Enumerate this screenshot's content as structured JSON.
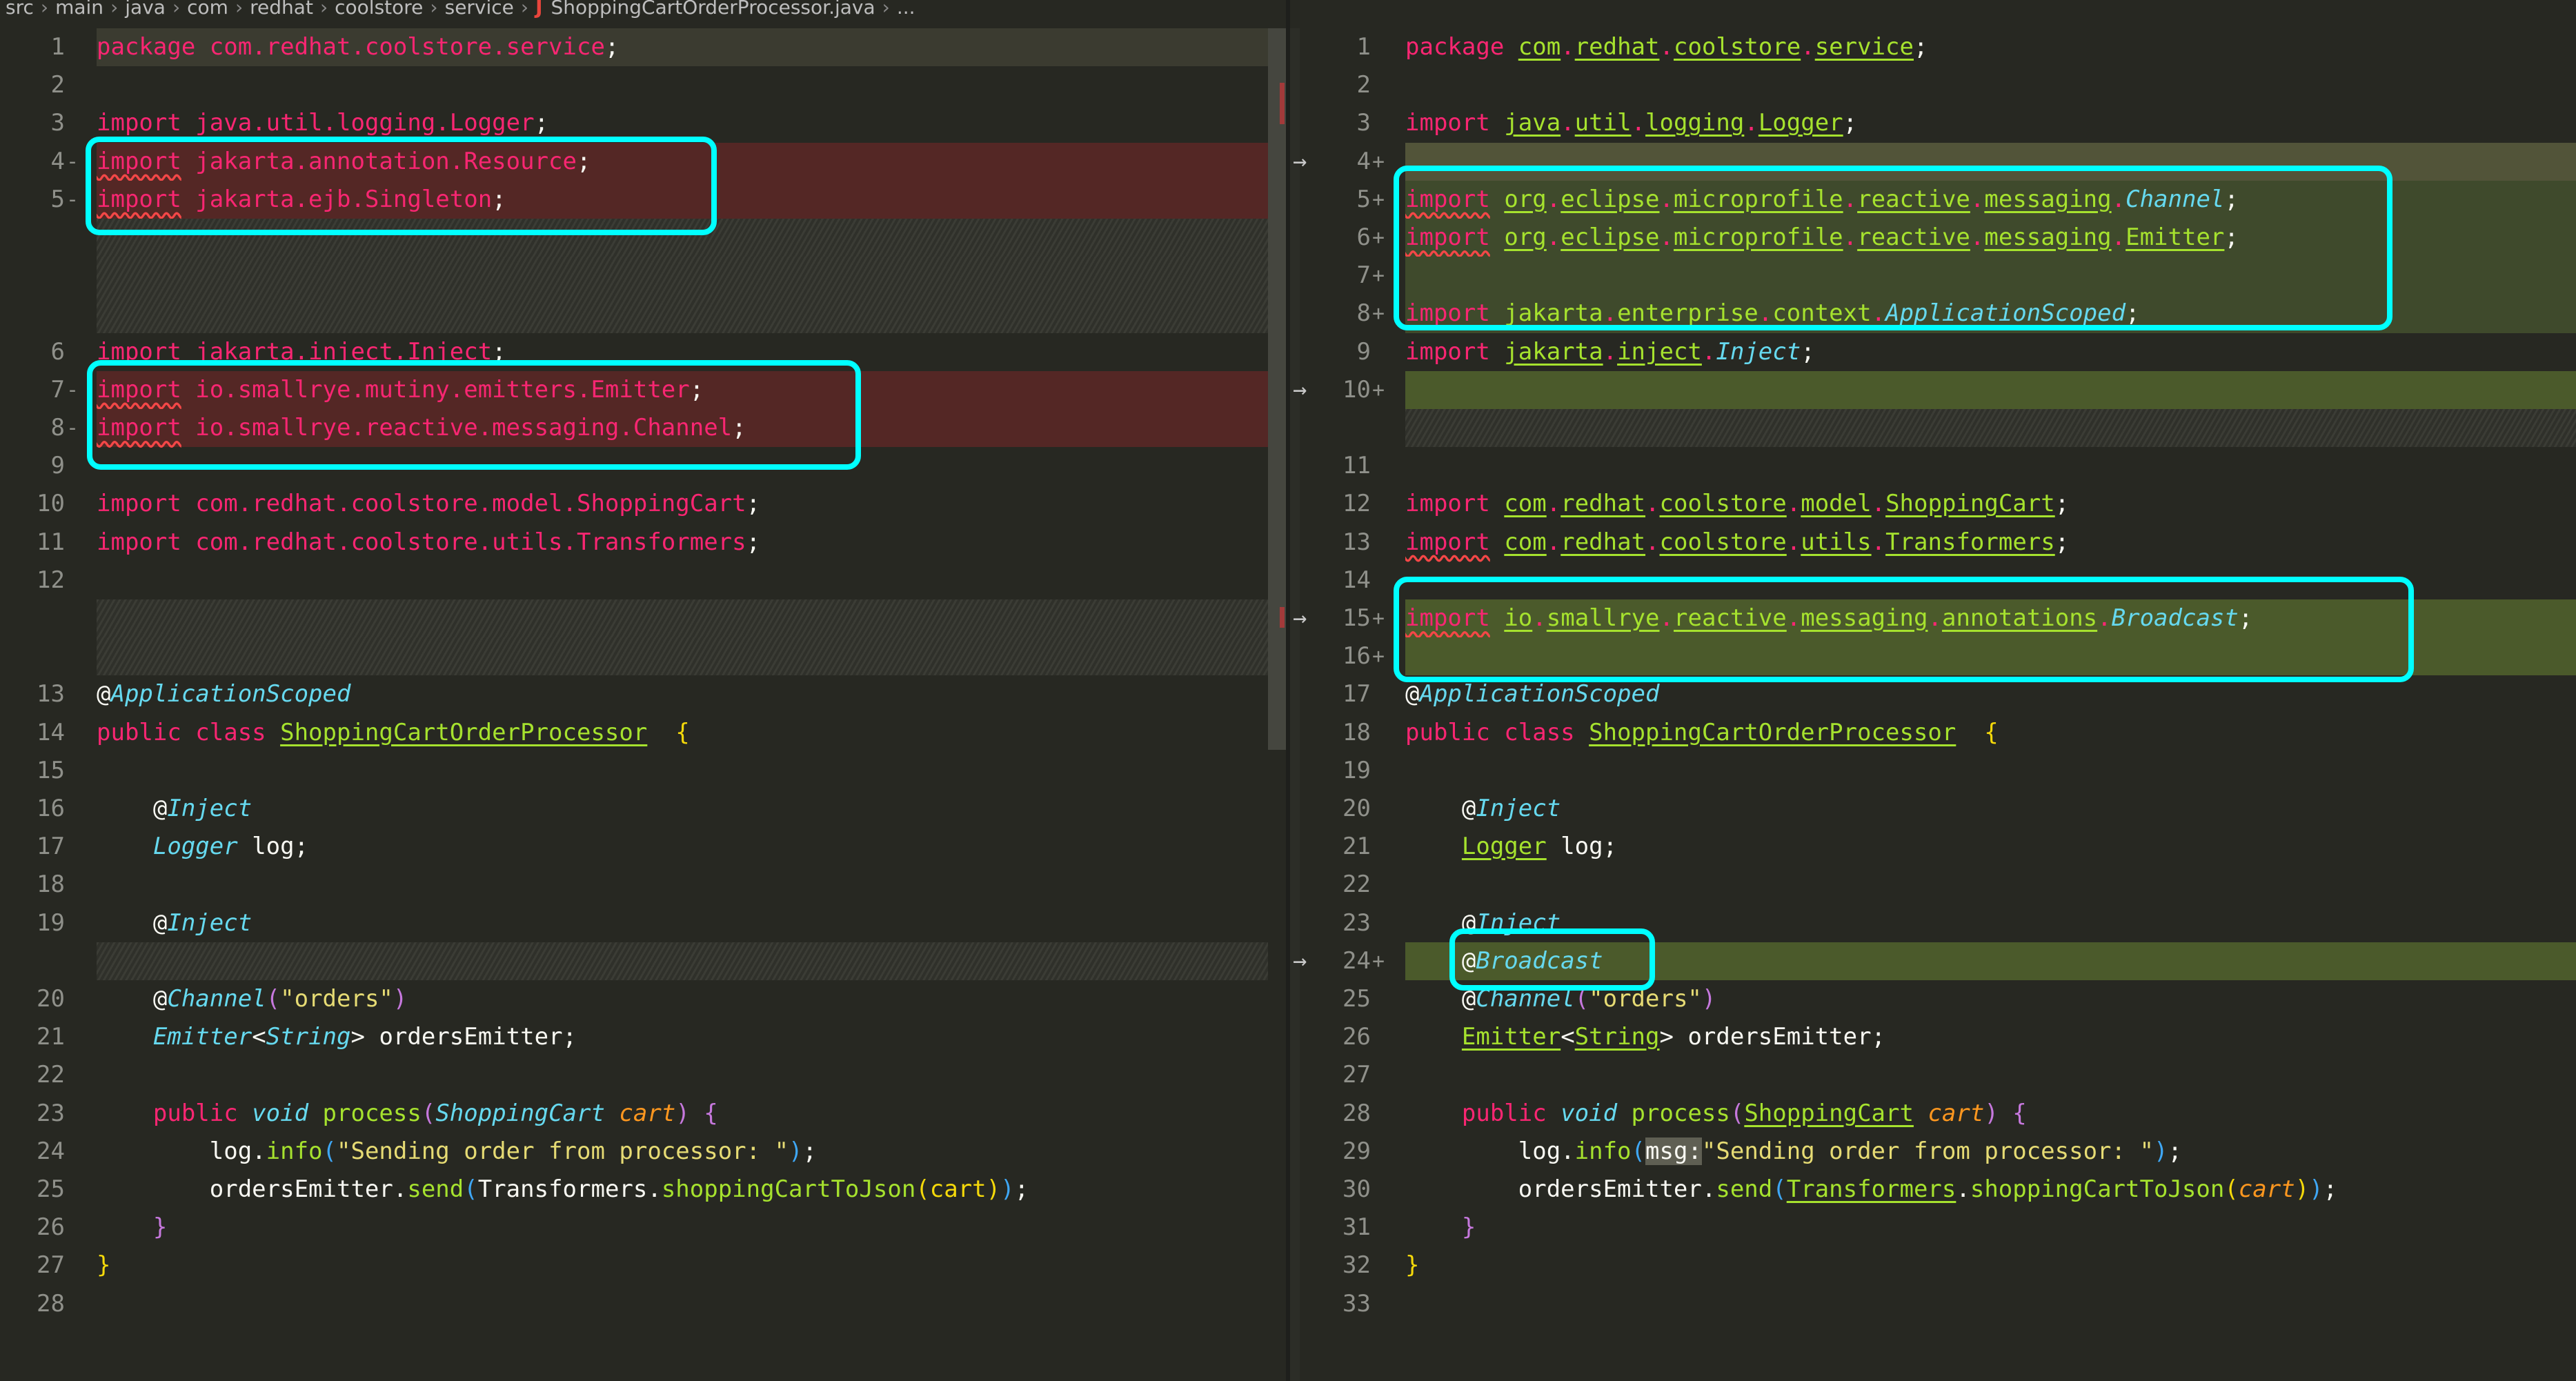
{
  "breadcrumb": [
    "src",
    "main",
    "java",
    "com",
    "redhat",
    "coolstore",
    "service"
  ],
  "file": {
    "icon": "java-icon",
    "glyph": "J",
    "name": "ShoppingCartOrderProcessor.java",
    "more": "..."
  },
  "colors": {
    "highlight_box": "#00ffff",
    "deleted": "#542725",
    "added": "#3f4a2c",
    "added_strong": "#4b5a2b",
    "current_line": "#3b3b30"
  },
  "left": [
    {
      "n": "1",
      "bg": "cur",
      "tk": [
        [
          "package com.redhat.coolstore.service",
          "del"
        ],
        [
          ";",
          "pl"
        ]
      ]
    },
    {
      "n": "2"
    },
    {
      "n": "3",
      "tk": [
        [
          "import java.util.logging.Logger",
          "del"
        ],
        [
          ";",
          "pl"
        ]
      ]
    },
    {
      "n": "4",
      "m": "-",
      "bg": "del",
      "tk": [
        [
          "import",
          "del sq"
        ],
        [
          " jakarta.annotation.Resource",
          "del"
        ],
        [
          ";",
          "pl"
        ]
      ]
    },
    {
      "n": "5",
      "m": "-",
      "bg": "del",
      "tk": [
        [
          "import",
          "del sq"
        ],
        [
          " jakarta.ejb.Singleton",
          "del"
        ],
        [
          ";",
          "pl"
        ]
      ]
    },
    {
      "fill": true
    },
    {
      "fill": true
    },
    {
      "fill": true
    },
    {
      "n": "6",
      "tk": [
        [
          "import jakarta.inject.Inject",
          "del"
        ],
        [
          ";",
          "pl"
        ]
      ]
    },
    {
      "n": "7",
      "m": "-",
      "bg": "del",
      "tk": [
        [
          "import",
          "del sq"
        ],
        [
          " io.smallrye.mutiny.emitters.Emitter",
          "del"
        ],
        [
          ";",
          "pl"
        ]
      ]
    },
    {
      "n": "8",
      "m": "-",
      "bg": "del",
      "tk": [
        [
          "import",
          "del sq"
        ],
        [
          " io.smallrye.reactive.messaging.Channel",
          "del"
        ],
        [
          ";",
          "pl"
        ]
      ]
    },
    {
      "n": "9"
    },
    {
      "n": "10",
      "tk": [
        [
          "import com.redhat.coolstore.model.ShoppingCart",
          "del"
        ],
        [
          ";",
          "pl"
        ]
      ]
    },
    {
      "n": "11",
      "tk": [
        [
          "import com.redhat.coolstore.utils.Transformers",
          "del"
        ],
        [
          ";",
          "pl"
        ]
      ]
    },
    {
      "n": "12"
    },
    {
      "fill": true
    },
    {
      "fill": true
    },
    {
      "n": "13",
      "tk": [
        [
          "@",
          "pl"
        ],
        [
          "ApplicationScoped",
          "it"
        ]
      ]
    },
    {
      "n": "14",
      "tk": [
        [
          "public class ",
          "kw"
        ],
        [
          "ShoppingCartOrderProcessor",
          "tyu"
        ],
        [
          "  ",
          "pl"
        ],
        [
          "{",
          "by"
        ]
      ]
    },
    {
      "n": "15"
    },
    {
      "n": "16",
      "tk": [
        [
          "    @",
          "pl"
        ],
        [
          "Inject",
          "it"
        ]
      ]
    },
    {
      "n": "17",
      "tk": [
        [
          "    ",
          "pl"
        ],
        [
          "Logger",
          "it"
        ],
        [
          " log;",
          "pl"
        ]
      ]
    },
    {
      "n": "18"
    },
    {
      "n": "19",
      "tk": [
        [
          "    @",
          "pl"
        ],
        [
          "Inject",
          "it"
        ]
      ]
    },
    {
      "fill": true
    },
    {
      "n": "20",
      "tk": [
        [
          "    @",
          "pl"
        ],
        [
          "Channel",
          "it"
        ],
        [
          "(",
          "br"
        ],
        [
          "\"orders\"",
          "st"
        ],
        [
          ")",
          "br"
        ]
      ]
    },
    {
      "n": "21",
      "tk": [
        [
          "    ",
          "pl"
        ],
        [
          "Emitter",
          "it"
        ],
        [
          "<",
          "pl"
        ],
        [
          "String",
          "it"
        ],
        [
          "> ordersEmitter;",
          "pl"
        ]
      ]
    },
    {
      "n": "22"
    },
    {
      "n": "23",
      "tk": [
        [
          "    public ",
          "kw"
        ],
        [
          "void ",
          "it"
        ],
        [
          "process",
          "ty"
        ],
        [
          "(",
          "br"
        ],
        [
          "ShoppingCart ",
          "it"
        ],
        [
          "cart",
          "pa"
        ],
        [
          ") ",
          "br"
        ],
        [
          "{",
          "br"
        ]
      ]
    },
    {
      "n": "24",
      "tk": [
        [
          "        log.",
          "pl"
        ],
        [
          "info",
          "ty"
        ],
        [
          "(",
          "bb"
        ],
        [
          "\"Sending order from processor: \"",
          "st"
        ],
        [
          ")",
          "bb"
        ],
        [
          ";",
          "pl"
        ]
      ]
    },
    {
      "n": "25",
      "tk": [
        [
          "        ordersEmitter.",
          "pl"
        ],
        [
          "send",
          "ty"
        ],
        [
          "(",
          "bb"
        ],
        [
          "Transformers.",
          "pl"
        ],
        [
          "shoppingCartToJson",
          "ty"
        ],
        [
          "(cart)",
          "by"
        ],
        [
          ")",
          "bb"
        ],
        [
          ";",
          "pl"
        ]
      ]
    },
    {
      "n": "26",
      "tk": [
        [
          "    }",
          "br"
        ]
      ]
    },
    {
      "n": "27",
      "tk": [
        [
          "}",
          "by"
        ]
      ]
    },
    {
      "n": "28"
    }
  ],
  "right": [
    {
      "n": "1",
      "tk": [
        [
          "package ",
          "kw"
        ],
        [
          "com",
          "tyu"
        ],
        [
          ".",
          "kw"
        ],
        [
          "redhat",
          "tyu"
        ],
        [
          ".",
          "kw"
        ],
        [
          "coolstore",
          "tyu"
        ],
        [
          ".",
          "kw"
        ],
        [
          "service",
          "tyu"
        ],
        [
          ";",
          "pl"
        ]
      ]
    },
    {
      "n": "2"
    },
    {
      "n": "3",
      "tk": [
        [
          "import ",
          "kw"
        ],
        [
          "java",
          "tyu"
        ],
        [
          ".",
          "kw"
        ],
        [
          "util",
          "tyu"
        ],
        [
          ".",
          "kw"
        ],
        [
          "logging",
          "tyu"
        ],
        [
          ".",
          "kw"
        ],
        [
          "Logger",
          "tyu"
        ],
        [
          ";",
          "pl"
        ]
      ]
    },
    {
      "n": "4",
      "m": "+",
      "bg": "mod",
      "arrow": "→"
    },
    {
      "n": "5",
      "m": "+",
      "bg": "add",
      "tk": [
        [
          "import",
          "kw sq"
        ],
        [
          " ",
          "pl"
        ],
        [
          "org",
          "tyu"
        ],
        [
          ".",
          "kw"
        ],
        [
          "eclipse",
          "tyu"
        ],
        [
          ".",
          "kw"
        ],
        [
          "microprofile",
          "tyu"
        ],
        [
          ".",
          "kw"
        ],
        [
          "reactive",
          "tyu"
        ],
        [
          ".",
          "kw"
        ],
        [
          "messaging",
          "tyu"
        ],
        [
          ".",
          "kw"
        ],
        [
          "Channel",
          "it"
        ],
        [
          ";",
          "pl"
        ]
      ]
    },
    {
      "n": "6",
      "m": "+",
      "bg": "add",
      "tk": [
        [
          "import",
          "kw sq"
        ],
        [
          " ",
          "pl"
        ],
        [
          "org",
          "tyu"
        ],
        [
          ".",
          "kw"
        ],
        [
          "eclipse",
          "tyu"
        ],
        [
          ".",
          "kw"
        ],
        [
          "microprofile",
          "tyu"
        ],
        [
          ".",
          "kw"
        ],
        [
          "reactive",
          "tyu"
        ],
        [
          ".",
          "kw"
        ],
        [
          "messaging",
          "tyu"
        ],
        [
          ".",
          "kw"
        ],
        [
          "Emitter",
          "tyu"
        ],
        [
          ";",
          "pl"
        ]
      ]
    },
    {
      "n": "7",
      "m": "+",
      "bg": "add"
    },
    {
      "n": "8",
      "m": "+",
      "bg": "add",
      "tk": [
        [
          "import ",
          "kw"
        ],
        [
          "jakarta",
          "ty"
        ],
        [
          ".",
          "kw"
        ],
        [
          "enterprise",
          "ty"
        ],
        [
          ".",
          "kw"
        ],
        [
          "context",
          "ty"
        ],
        [
          ".",
          "kw"
        ],
        [
          "ApplicationScoped",
          "it"
        ],
        [
          ";",
          "pl"
        ]
      ]
    },
    {
      "n": "9",
      "tk": [
        [
          "import ",
          "kw"
        ],
        [
          "jakarta",
          "tyu"
        ],
        [
          ".",
          "kw"
        ],
        [
          "inject",
          "tyu"
        ],
        [
          ".",
          "kw"
        ],
        [
          "Inject",
          "it"
        ],
        [
          ";",
          "pl"
        ]
      ]
    },
    {
      "n": "10",
      "m": "+",
      "bg": "add2",
      "arrow": "→"
    },
    {
      "fill": true
    },
    {
      "n": "11"
    },
    {
      "n": "12",
      "tk": [
        [
          "import ",
          "kw"
        ],
        [
          "com",
          "tyu"
        ],
        [
          ".",
          "kw"
        ],
        [
          "redhat",
          "tyu"
        ],
        [
          ".",
          "kw"
        ],
        [
          "coolstore",
          "tyu"
        ],
        [
          ".",
          "kw"
        ],
        [
          "model",
          "tyu"
        ],
        [
          ".",
          "kw"
        ],
        [
          "ShoppingCart",
          "tyu"
        ],
        [
          ";",
          "pl"
        ]
      ]
    },
    {
      "n": "13",
      "tk": [
        [
          "import",
          "kw sq"
        ],
        [
          " ",
          "pl"
        ],
        [
          "com",
          "tyu"
        ],
        [
          ".",
          "kw"
        ],
        [
          "redhat",
          "tyu"
        ],
        [
          ".",
          "kw"
        ],
        [
          "coolstore",
          "tyu"
        ],
        [
          ".",
          "kw"
        ],
        [
          "utils",
          "tyu"
        ],
        [
          ".",
          "kw"
        ],
        [
          "Transformers",
          "tyu"
        ],
        [
          ";",
          "pl"
        ]
      ]
    },
    {
      "n": "14"
    },
    {
      "n": "15",
      "m": "+",
      "bg": "add2",
      "arrow": "→",
      "tk": [
        [
          "import",
          "kw sq"
        ],
        [
          " ",
          "pl"
        ],
        [
          "io",
          "tyu"
        ],
        [
          ".",
          "kw"
        ],
        [
          "smallrye",
          "tyu"
        ],
        [
          ".",
          "kw"
        ],
        [
          "reactive",
          "tyu"
        ],
        [
          ".",
          "kw"
        ],
        [
          "messaging",
          "tyu"
        ],
        [
          ".",
          "kw"
        ],
        [
          "annotations",
          "tyu"
        ],
        [
          ".",
          "kw"
        ],
        [
          "Broadcast",
          "it"
        ],
        [
          ";",
          "pl"
        ]
      ]
    },
    {
      "n": "16",
      "m": "+",
      "bg": "add2"
    },
    {
      "n": "17",
      "tk": [
        [
          "@",
          "pl"
        ],
        [
          "ApplicationScoped",
          "it"
        ]
      ]
    },
    {
      "n": "18",
      "tk": [
        [
          "public class ",
          "kw"
        ],
        [
          "ShoppingCartOrderProcessor",
          "tyu"
        ],
        [
          "  ",
          "pl"
        ],
        [
          "{",
          "by"
        ]
      ]
    },
    {
      "n": "19"
    },
    {
      "n": "20",
      "tk": [
        [
          "    @",
          "pl"
        ],
        [
          "Inject",
          "it"
        ]
      ]
    },
    {
      "n": "21",
      "tk": [
        [
          "    ",
          "pl"
        ],
        [
          "Logger",
          "tyu"
        ],
        [
          " log;",
          "pl"
        ]
      ]
    },
    {
      "n": "22"
    },
    {
      "n": "23",
      "tk": [
        [
          "    @",
          "pl"
        ],
        [
          "Inject",
          "it"
        ]
      ]
    },
    {
      "n": "24",
      "m": "+",
      "bg": "add2",
      "arrow": "→",
      "tk": [
        [
          "    @",
          "pl"
        ],
        [
          "Broadcast",
          "it"
        ]
      ]
    },
    {
      "n": "25",
      "tk": [
        [
          "    @",
          "pl"
        ],
        [
          "Channel",
          "it"
        ],
        [
          "(",
          "br"
        ],
        [
          "\"orders\"",
          "st"
        ],
        [
          ")",
          "br"
        ]
      ]
    },
    {
      "n": "26",
      "tk": [
        [
          "    ",
          "pl"
        ],
        [
          "Emitter",
          "tyu"
        ],
        [
          "<",
          "pl"
        ],
        [
          "String",
          "tyu"
        ],
        [
          "> ordersEmitter;",
          "pl"
        ]
      ]
    },
    {
      "n": "27"
    },
    {
      "n": "28",
      "tk": [
        [
          "    public ",
          "kw"
        ],
        [
          "void ",
          "it"
        ],
        [
          "process",
          "ty"
        ],
        [
          "(",
          "br"
        ],
        [
          "ShoppingCart",
          "tyu"
        ],
        [
          " ",
          "pl"
        ],
        [
          "cart",
          "pa"
        ],
        [
          ") ",
          "br"
        ],
        [
          "{",
          "br"
        ]
      ]
    },
    {
      "n": "29",
      "tk": [
        [
          "        log.",
          "pl"
        ],
        [
          "info",
          "ty"
        ],
        [
          "(",
          "bb"
        ],
        [
          "msg:",
          "hint"
        ],
        [
          "\"Sending order from processor: \"",
          "st"
        ],
        [
          ")",
          "bb"
        ],
        [
          ";",
          "pl"
        ]
      ]
    },
    {
      "n": "30",
      "tk": [
        [
          "        ordersEmitter.",
          "pl"
        ],
        [
          "send",
          "ty"
        ],
        [
          "(",
          "bb"
        ],
        [
          "Transformers",
          "tyu"
        ],
        [
          ".",
          "pl"
        ],
        [
          "shoppingCartToJson",
          "ty"
        ],
        [
          "(",
          "by"
        ],
        [
          "cart",
          "pa"
        ],
        [
          ")",
          "by"
        ],
        [
          ")",
          "bb"
        ],
        [
          ";",
          "pl"
        ]
      ]
    },
    {
      "n": "31",
      "tk": [
        [
          "    }",
          "br"
        ]
      ]
    },
    {
      "n": "32",
      "tk": [
        [
          "}",
          "by"
        ]
      ]
    },
    {
      "n": "33"
    }
  ]
}
